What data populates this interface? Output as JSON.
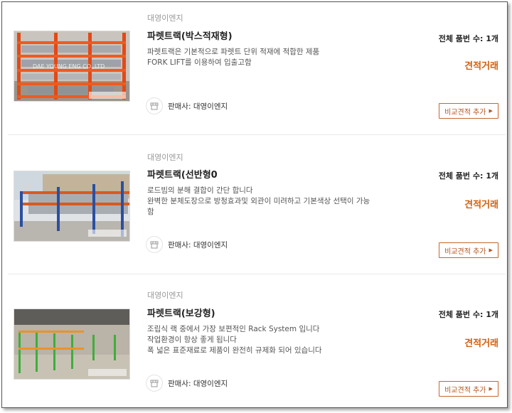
{
  "products": [
    {
      "company": "대영이엔지",
      "title": "파렛트랙(박스적재형)",
      "desc": [
        "파렛트랙은 기본적으로 파렛트 단위 적재에 적합한 제품",
        "FORK LIFT를 이용하여 입출고함"
      ],
      "seller": "판매사: 대영이엔지",
      "count": "전체 품번 수: 1개",
      "quote": "견적거래",
      "compare": "비교견적 추가",
      "image_alt": "DAE YOUNG ENG CO.,LTD"
    },
    {
      "company": "대영이엔지",
      "title": "파렛트랙(선반형0",
      "desc": [
        "로드빔의 분해 결합이 간단 합니다",
        "완벽한 분체도장으로 방청효과및 외관이 미려하고 기본색상 선택이 가능",
        "함"
      ],
      "seller": "판매사: 대영이엔지",
      "count": "전체 품번 수: 1개",
      "quote": "견적거래",
      "compare": "비교견적 추가"
    },
    {
      "company": "대영이엔지",
      "title": "파렛트랙(보강형)",
      "desc": [
        "조립식 랙 중에서 가장 보편적인 Rack System 입니다",
        "작업환경이 항상 좋게 됩니다",
        "폭 넓은 표준재료로 제품이 완전히 규제화 되어 있습니다"
      ],
      "seller": "판매사: 대영이엔지",
      "count": "전체 품번 수: 1개",
      "quote": "견적거래",
      "compare": "비교견적 추가"
    }
  ],
  "colors": {
    "accent": "#d35f0b",
    "button_border": "#c8652a"
  },
  "icons": {
    "seller": "store-icon",
    "compare": "arrow-right-icon"
  }
}
